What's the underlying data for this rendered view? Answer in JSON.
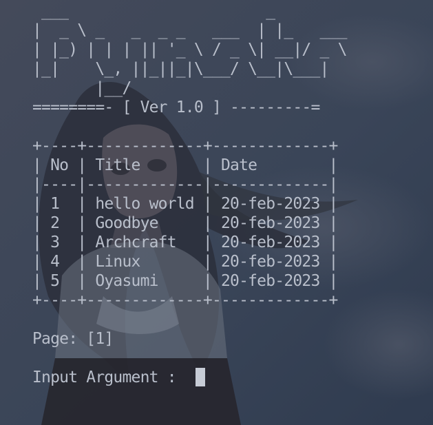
{
  "terminal": {
    "banner_lines": [
      " ___                      _",
      "|  _ \\ _   _  _ _   ___  | |_   ___",
      "| |_) | | | || '_ \\ / _ \\| __|/ _ \\",
      "|_|    \\_, ||_||_|\\___/ \\__|\\___|",
      "       |__/"
    ],
    "version_line": "========- [ Ver 1.0 ] ---------=",
    "table": {
      "border_top": "+----+-------------+-------------+",
      "header_row": "| No | Title       | Date        |",
      "header_separator": "|----|-------------|-------------|",
      "rows": [
        "| 1  | hello world | 20-feb-2023 |",
        "| 2  | Goodbye     | 20-feb-2023 |",
        "| 3  | Archcraft   | 20-feb-2023 |",
        "| 4  | Linux       | 20-feb-2023 |",
        "| 5  | Oyasumi     | 20-feb-2023 |"
      ],
      "border_bottom": "+----+-------------+-------------+"
    },
    "page_line": "Page: [1]",
    "prompt": "Input Argument : "
  },
  "colors": {
    "background": "#3a4557",
    "foreground": "#b9bfcb",
    "cursor": "#c7ccd6"
  }
}
